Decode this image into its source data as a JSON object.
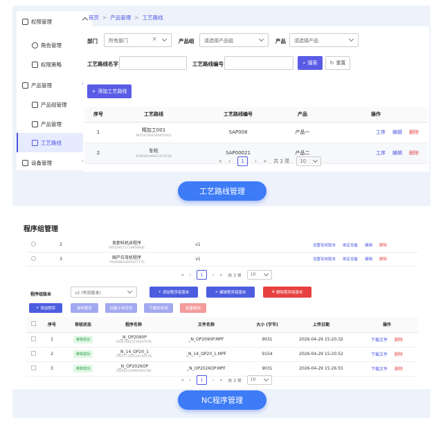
{
  "panel1": {
    "sidebar": [
      {
        "label": "权限管理",
        "icon": "user-icon",
        "type": "group"
      },
      {
        "label": "角色管理",
        "icon": "user-icon",
        "type": "item"
      },
      {
        "label": "权限策略",
        "icon": "doc-icon",
        "type": "item"
      },
      {
        "label": "产品管理",
        "icon": "box-icon",
        "type": "group"
      },
      {
        "label": "产品组管理",
        "icon": "layers-icon",
        "type": "item"
      },
      {
        "label": "产品管理",
        "icon": "doc-icon",
        "type": "item"
      },
      {
        "label": "工艺路线",
        "icon": "route-icon",
        "type": "item"
      },
      {
        "label": "设备管理",
        "icon": "device-icon",
        "type": "group"
      }
    ],
    "breadcrumb": [
      "首页",
      "产品管理",
      "工艺路线"
    ],
    "filters": {
      "dept_label": "部门",
      "dept_value": "所有部门",
      "group_label": "产品组",
      "group_ph": "请选择产品组",
      "product_label": "产品",
      "product_ph": "请选择产品",
      "route_name_label": "工艺路线名字",
      "route_no_label": "工艺路线编号",
      "search": "搜索",
      "reset": "重置"
    },
    "add_button": "添加工艺路线",
    "headers": [
      "序号",
      "工艺路线",
      "工艺路线编号",
      "产品",
      "操作"
    ],
    "rows": [
      {
        "no": "1",
        "name": "精加工001",
        "id": "687247604349670501",
        "code": "SAP008",
        "product": "产品一"
      },
      {
        "no": "2",
        "name": "车轮",
        "id": "839545446831475158",
        "code": "SAP00021",
        "product": "产品二"
      }
    ],
    "actions": [
      "工序",
      "编辑",
      "删除"
    ],
    "pager": {
      "page": "1",
      "total": "共 2 项",
      "size": "10"
    },
    "caption": "工艺路线管理"
  },
  "panel2": {
    "title": "程序组管理",
    "top_rows": [
      {
        "no": "2",
        "name": "发那科机床程序",
        "id": "687249571719856666",
        "ver": "v1"
      },
      {
        "no": "3",
        "name": "国产拉弯机程序",
        "id": "700058816695477770",
        "ver": "v1"
      }
    ],
    "top_actions": [
      "设置有效版本",
      "绑定设备",
      "编辑",
      "删除"
    ],
    "pager_top": {
      "page": "1",
      "total": "共 3 项",
      "size": "10"
    },
    "version_label": "程序组版本",
    "version_value": "v2 (有效版本)",
    "btn_add_version": "添加程序组版本",
    "btn_edit_version": "编辑程序组版本",
    "btn_del_version": "删除程序组版本",
    "btn_add_program": "添加程序",
    "btn_compare": "审核程序",
    "btn_upload": "创建上传任务",
    "btn_download": "下载到本地",
    "btn_batch_delete": "批量删除",
    "headers": [
      "序号",
      "审核状态",
      "程序名称",
      "文件名称",
      "大小 (字节)",
      "上传日期",
      "操作"
    ],
    "rows": [
      {
        "no": "1",
        "status": "审核成功",
        "name": "_N_OP2090P",
        "id": "700576823736547678",
        "file": "_N_OP2090P.MPF",
        "size": "9031",
        "date": "2026-04-29 15:20:32"
      },
      {
        "no": "2",
        "status": "审核成功",
        "name": "_N_14_OP20_1",
        "id": "700577162524150578",
        "file": "_N_14_OP20_1.MPF",
        "size": "9154",
        "date": "2026-04-29 15:20:52"
      },
      {
        "no": "3",
        "status": "审核成功",
        "name": "_N_OP2026OP",
        "id": "700582239962902782",
        "file": "_N_OP2026OP.MPF",
        "size": "9031",
        "date": "2026-04-29 15:26:55"
      }
    ],
    "row_actions": [
      "下载文件",
      "删除"
    ],
    "pager": {
      "page": "1",
      "total": "共 3 项",
      "size": "10"
    },
    "caption": "NC程序管理"
  }
}
